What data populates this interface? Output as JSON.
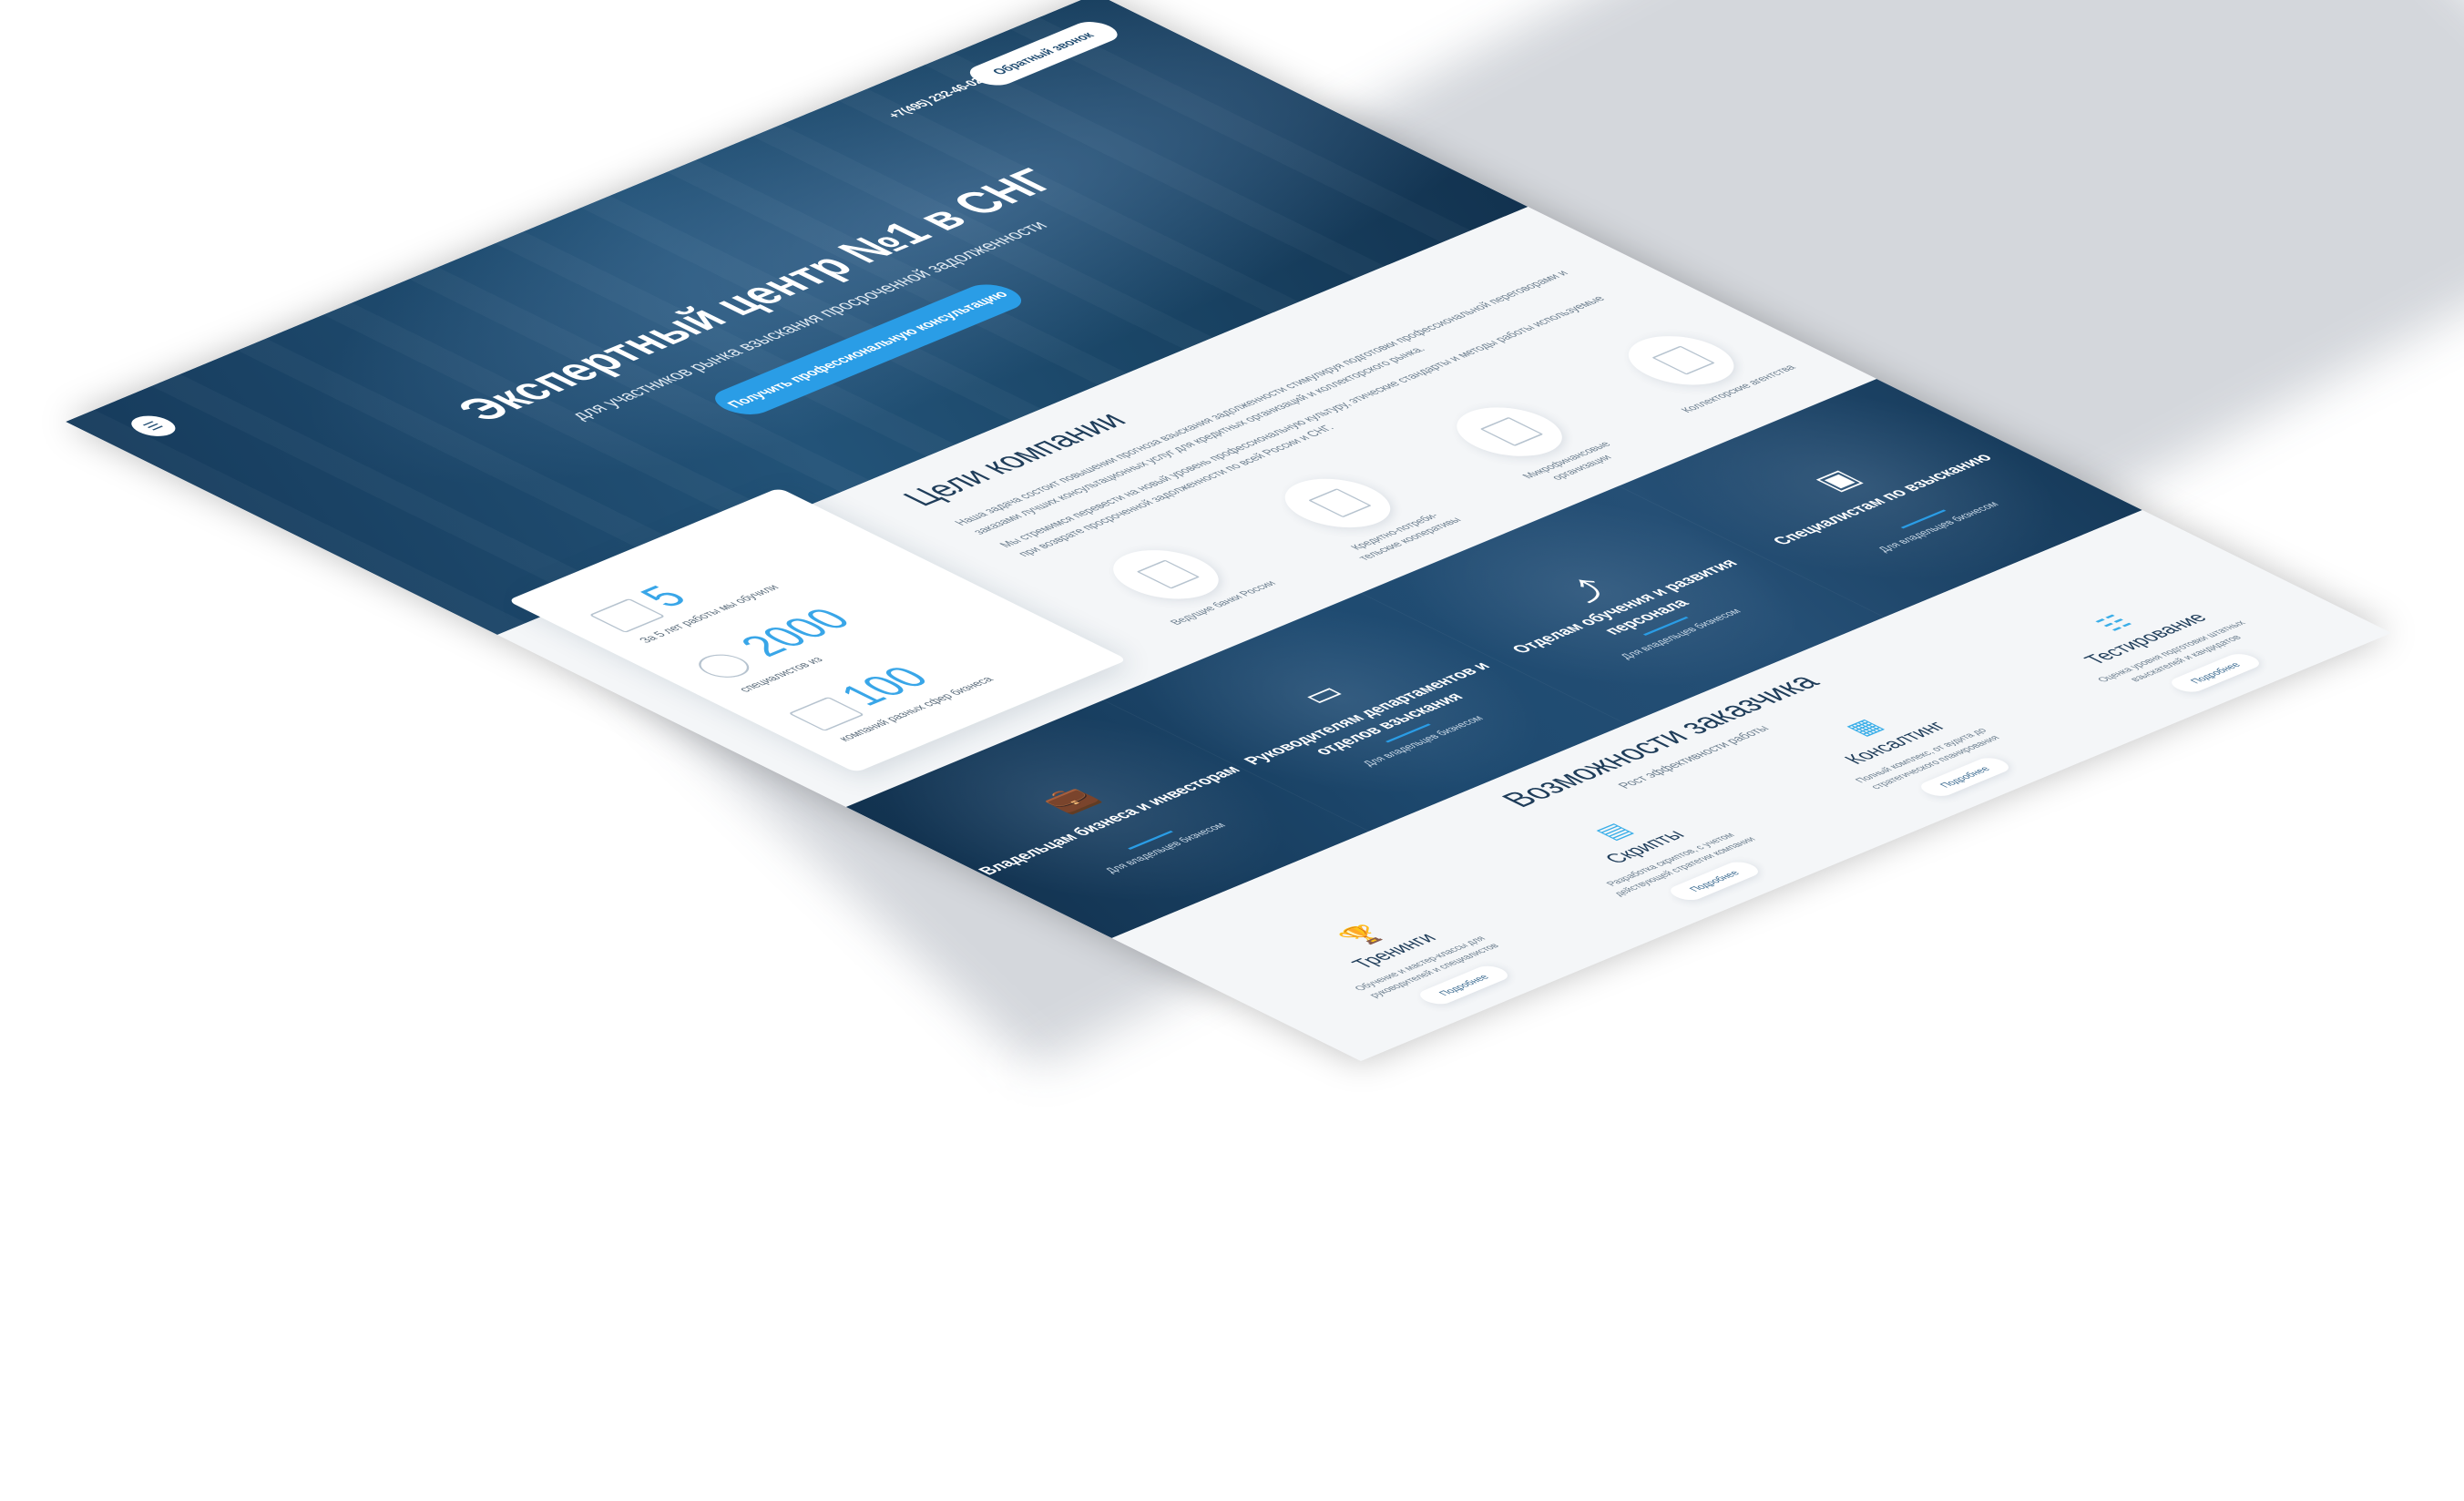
{
  "header": {
    "phone": "+7(495) 232-46-02",
    "callback_label": "Обратный звонок",
    "menu_icon": "menu-icon"
  },
  "hero": {
    "title": "Экспертный центр №1 в СНГ",
    "subtitle": "для участников рынка взыскания просроченной задолженности",
    "cta_label": "Получить профессиональную консультацию"
  },
  "goals": {
    "title": "Цели компании",
    "paragraphs": [
      "Наша задача состоит повышении прогноза взыскания задолженности стимулируя подготовки профессиональной переговорами и заказами лучших консультационных услуг для кредитных организаций и коллекторского рынка.",
      "Мы стремимся перевести на новый уровень профессиональную культуру, этические стандарты и методы работы используемые при возврате просроченной задолженности по всей России и СНГ."
    ],
    "stats": [
      {
        "num": "5",
        "label": "За 5 лет работы мы обучили"
      },
      {
        "num": "2000",
        "label": "специалистов из"
      },
      {
        "num": "100",
        "label": "компаний разных сфер бизнеса"
      }
    ],
    "orgs": [
      {
        "label": "Ведущие банки России"
      },
      {
        "label": "Кредитно-потреби-тельские кооперативы"
      },
      {
        "label": "Микрофинансовые организации"
      },
      {
        "label": "Коллекторские агентства"
      }
    ]
  },
  "audience": [
    {
      "title": "Владельцам бизнеса и инвесторам",
      "sub": "Для владельцев бизнесом",
      "icon": "briefcase-icon"
    },
    {
      "title": "Руководителям департаментов и отделов взыскания",
      "sub": "Для владельцев бизнесом",
      "icon": "presentation-icon"
    },
    {
      "title": "Отделам обучения и развития персонала",
      "sub": "Для владельцев бизнесом",
      "icon": "growth-icon"
    },
    {
      "title": "Специалистам по взысканию",
      "sub": "Для владельцев бизнесом",
      "icon": "wallet-icon"
    }
  ],
  "features": {
    "title": "Возможности заказчика",
    "subtitle": "Рост эффективности работы",
    "items": [
      {
        "title": "Тренинги",
        "desc": "Обучение и мастер-классы для руководителей и специалистов",
        "button": "Подробнее",
        "icon": "trophy-icon"
      },
      {
        "title": "Скрипты",
        "desc": "Разработка скриптов, с учетом действующей стратегии компании",
        "button": "Подробнее",
        "icon": "document-icon"
      },
      {
        "title": "Консалтинг",
        "desc": "Полный комплекс, от аудита до стратегического планирования",
        "button": "Подробнее",
        "icon": "consulting-icon"
      },
      {
        "title": "Тестирование",
        "desc": "Оценка уровня подготовки штатных взыскателей и кандидатов",
        "button": "Подробнее",
        "icon": "test-icon"
      }
    ]
  }
}
